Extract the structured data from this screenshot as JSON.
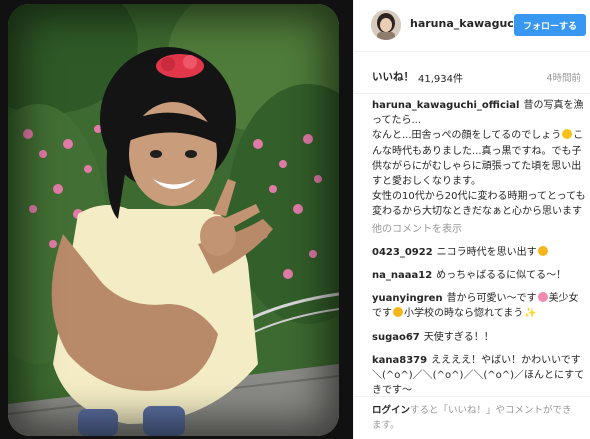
{
  "post": {
    "username": "haruna_kawaguc...",
    "follow_label": "フォローする",
    "likes_label": "いいね！",
    "likes_count": "41,934件",
    "timestamp": "4時間前"
  },
  "caption": {
    "author": "haruna_kawaguchi_official",
    "text_1": "昔の写真を漁ってたら...",
    "text_2": "なんと...田舎っぺの顔をしてるのでしょう",
    "text_3": "こんな時代もありました...真っ黒ですね。でも子供ながらにがむしゃらに頑張ってた頃を思い出すと愛おしくなります。",
    "text_4": "女性の10代から20代に変わる時期ってとっても変わるから大切なときだなぁと心から思います"
  },
  "view_more_label": "他のコメントを表示",
  "comments": [
    {
      "author": "0423_0922",
      "text_1": "ニコラ時代を思い出す"
    },
    {
      "author": "na_naaa12",
      "text_1": "めっちゃばるるに似てる〜！"
    },
    {
      "author": "yuanyingren",
      "text_1": "昔から可愛い〜です",
      "text_2": "美少女です",
      "text_3": "小学校の時なら惚れてまう"
    },
    {
      "author": "sugao67",
      "text_1": "天使すぎる！！"
    },
    {
      "author": "kana8379",
      "text_1": "ええええ！やばい！かわいいです＼(^o^)／＼(^o^)／＼(^o^)／ほんとにすてきです〜"
    }
  ],
  "footer": {
    "login_label": "ログイン",
    "text": "すると「いいね！」やコメントができます。"
  },
  "colors": {
    "follow_button": "#3897f0",
    "text_primary": "#262626",
    "text_secondary": "#999999",
    "divider": "#efefef"
  },
  "icons": [
    "heart-eyes-emoji",
    "smile-emoji",
    "sparkle-emoji"
  ]
}
